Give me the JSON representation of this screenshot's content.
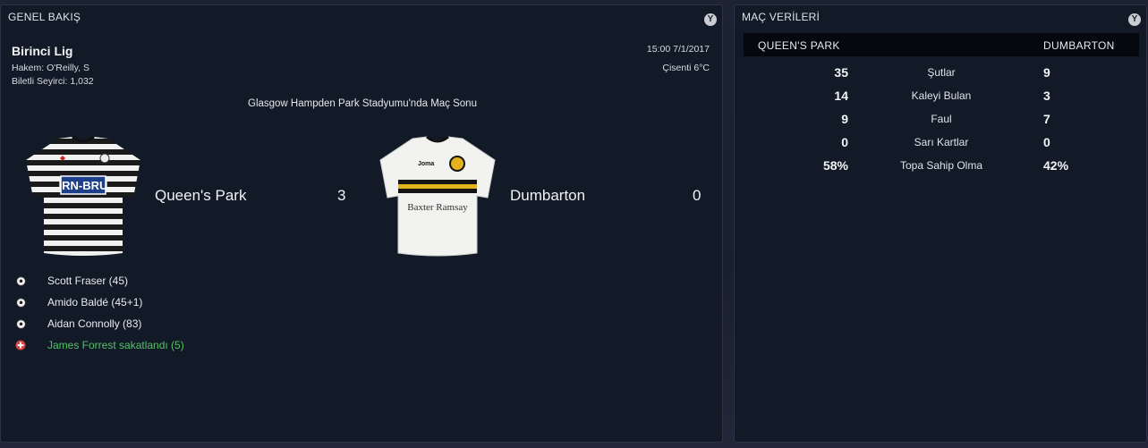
{
  "overview": {
    "title": "GENEL BAKIŞ",
    "collapse_label": "Y",
    "competition": "Birinci Lig",
    "referee": "Hakem: O'Reilly, S",
    "attendance": "Biletli Seyirci: 1,032",
    "datetime": "15:00 7/1/2017",
    "weather": "Çisenti 6°C",
    "venue": "Glasgow Hampden Park Stadyumu'nda Maç Sonu",
    "home": {
      "name": "Queen's Park",
      "score": "3",
      "kit_sponsor": "IRN-BRU"
    },
    "away": {
      "name": "Dumbarton",
      "score": "0",
      "kit_sponsor": "Baxter Ramsay",
      "kit_brand": "Joma"
    },
    "events": [
      {
        "text": "Scott Fraser (45)",
        "icon": "football-icon",
        "type": "goal"
      },
      {
        "text": "Amido Baldé (45+1)",
        "icon": "football-icon",
        "type": "goal"
      },
      {
        "text": "Aidan Connolly (83)",
        "icon": "football-icon",
        "type": "goal"
      },
      {
        "text": "James Forrest sakatlandı (5)",
        "icon": "injury-icon",
        "type": "injury"
      }
    ]
  },
  "matchdata": {
    "title": "MAÇ VERİLERİ",
    "collapse_label": "Y",
    "home_header": "QUEEN'S PARK",
    "away_header": "DUMBARTON",
    "stats": [
      {
        "label": "Şutlar",
        "home": "35",
        "away": "9"
      },
      {
        "label": "Kaleyi Bulan",
        "home": "14",
        "away": "3"
      },
      {
        "label": "Faul",
        "home": "9",
        "away": "7"
      },
      {
        "label": "Sarı Kartlar",
        "home": "0",
        "away": "0"
      },
      {
        "label": "Topa Sahip Olma",
        "home": "58%",
        "away": "42%"
      }
    ]
  },
  "colors": {
    "panel_bg": "#111a26",
    "injury_text": "#57c16a",
    "injury_icon": "#d9453a"
  }
}
